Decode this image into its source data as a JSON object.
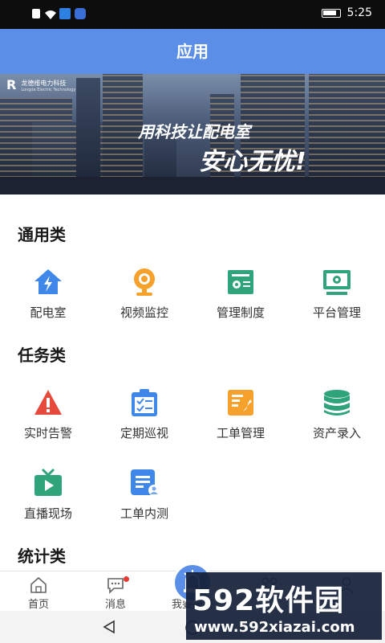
{
  "status_bar": {
    "time": "5:25"
  },
  "header": {
    "title": "应用"
  },
  "banner": {
    "company": "龙德维电力科技",
    "company_sub": "Longde Electric Technology",
    "slogan_line1": "用科技让配电室",
    "slogan_line2": "安心无忧!"
  },
  "sections": [
    {
      "title": "通用类",
      "items": [
        {
          "label": "配电室",
          "icon": "house-lightning-icon"
        },
        {
          "label": "视频监控",
          "icon": "webcam-icon"
        },
        {
          "label": "管理制度",
          "icon": "document-icon"
        },
        {
          "label": "平台管理",
          "icon": "monitor-gear-icon"
        }
      ]
    },
    {
      "title": "任务类",
      "items": [
        {
          "label": "实时告警",
          "icon": "warning-triangle-icon"
        },
        {
          "label": "定期巡视",
          "icon": "clipboard-check-icon"
        },
        {
          "label": "工单管理",
          "icon": "wrench-document-icon"
        },
        {
          "label": "资产录入",
          "icon": "database-icon"
        },
        {
          "label": "直播现场",
          "icon": "tv-play-icon"
        },
        {
          "label": "工单内测",
          "icon": "doc-user-icon"
        }
      ]
    },
    {
      "title": "统计类",
      "items": []
    }
  ],
  "tab_bar": {
    "tabs": [
      {
        "label": "首页",
        "icon": "home-icon"
      },
      {
        "label": "消息",
        "icon": "chat-icon"
      },
      {
        "label": "我要报警",
        "icon": "alarm-siren-icon"
      },
      {
        "label": "",
        "icon": "apps-icon"
      },
      {
        "label": "",
        "icon": "user-icon"
      }
    ]
  },
  "watermark": {
    "brand": "592软件园",
    "url": "www.592xiazai.com"
  },
  "colors": {
    "header_bg": "#5b8ee6",
    "icon_blue": "#3f87e8",
    "icon_orange": "#f5a12b",
    "icon_green": "#2fa37a",
    "icon_red": "#e64a3c"
  }
}
